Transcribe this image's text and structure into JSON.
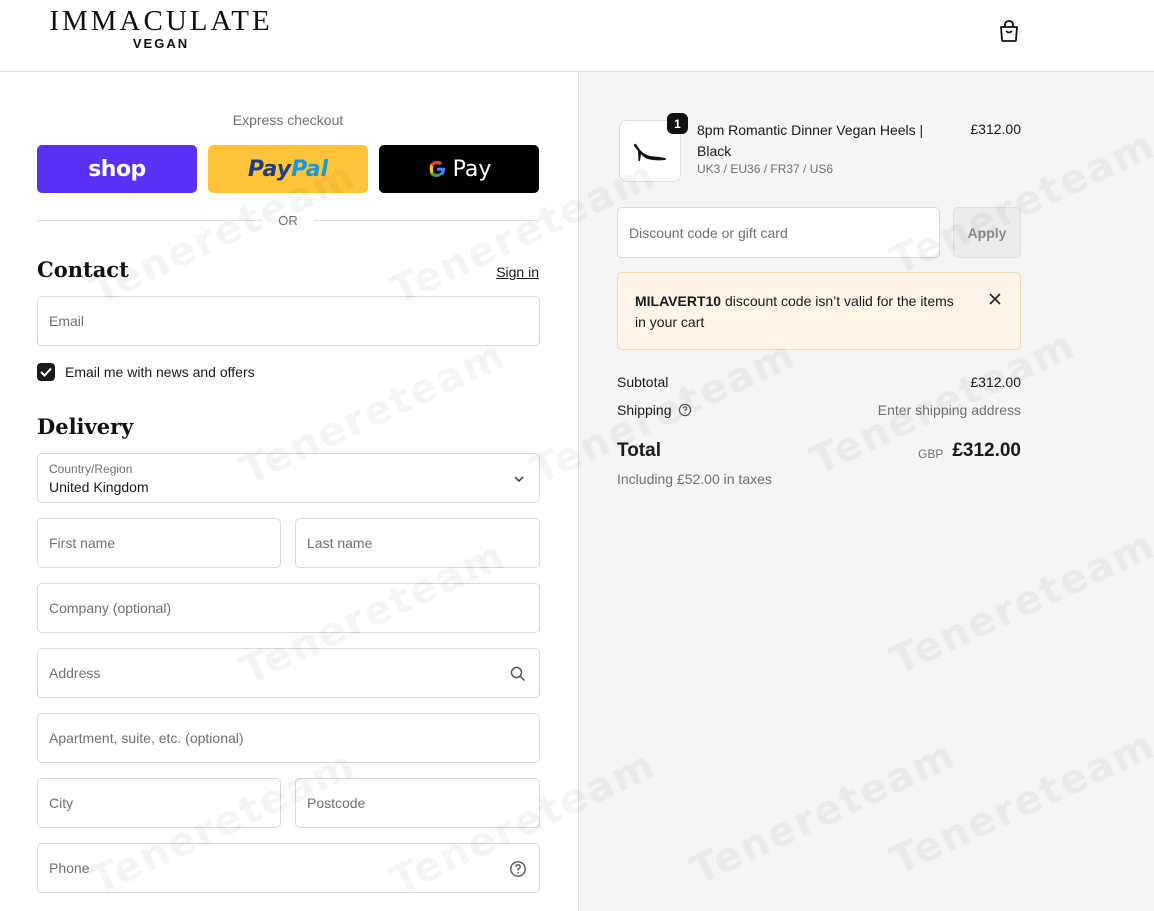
{
  "brand": {
    "name": "IMMACULATE",
    "sub": "VEGAN"
  },
  "header": {
    "cart_icon": "shopping-bag-icon"
  },
  "express": {
    "title": "Express checkout",
    "shop_label": "shop",
    "paypal_label_dark": "Pay",
    "paypal_label_light": "Pal",
    "gpay_label": "Pay",
    "or_text": "OR",
    "colors": {
      "shop": "#5a31f4",
      "paypal": "#ffc439",
      "gpay": "#000000"
    }
  },
  "contact": {
    "title": "Contact",
    "signin": "Sign in",
    "email_placeholder": "Email",
    "newsletter_label": "Email me with news and offers",
    "newsletter_checked": true
  },
  "delivery": {
    "title": "Delivery",
    "country_label": "Country/Region",
    "country_value": "United Kingdom",
    "first_name_placeholder": "First name",
    "last_name_placeholder": "Last name",
    "company_placeholder": "Company (optional)",
    "address_placeholder": "Address",
    "apartment_placeholder": "Apartment, suite, etc. (optional)",
    "city_placeholder": "City",
    "postcode_placeholder": "Postcode",
    "phone_placeholder": "Phone"
  },
  "order": {
    "product": {
      "quantity": "1",
      "name": "8pm Romantic Dinner Vegan Heels | Black",
      "variant": "UK3 / EU36 / FR37 / US6",
      "price": "£312.00"
    },
    "discount_placeholder": "Discount code or gift card",
    "apply_label": "Apply",
    "error": {
      "code": "MILAVERT10",
      "message": " discount code isn’t valid for the items in your cart"
    },
    "subtotal_label": "Subtotal",
    "subtotal_value": "£312.00",
    "shipping_label": "Shipping",
    "shipping_value": "Enter shipping address",
    "total_label": "Total",
    "total_currency": "GBP",
    "total_value": "£312.00",
    "tax_note": "Including £52.00 in taxes"
  },
  "watermark_text": "Tenereteam"
}
